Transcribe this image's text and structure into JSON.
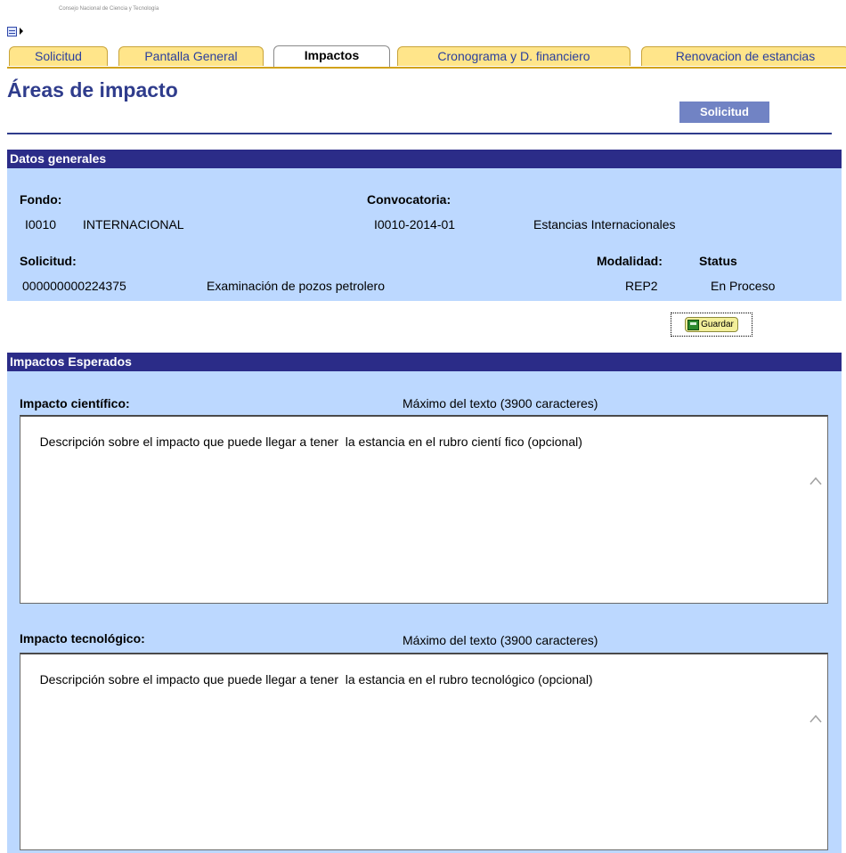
{
  "header": {
    "faint_text": "Consejo Nacional de Ciencia y Tecnología"
  },
  "tabs": [
    {
      "label": "Solicitud",
      "active": false
    },
    {
      "label": "Pantalla General",
      "active": false
    },
    {
      "label": "Impactos",
      "active": true
    },
    {
      "label": "Cronograma y D. financiero",
      "active": false
    },
    {
      "label": "Renovacion de estancias",
      "active": false
    }
  ],
  "page": {
    "title": "Áreas de impacto",
    "solicitud_button": "Solicitud"
  },
  "datos_generales": {
    "header": "Datos generales",
    "fondo_label": "Fondo:",
    "fondo_code": "I0010",
    "fondo_name": "INTERNACIONAL",
    "convocatoria_label": "Convocatoria:",
    "convocatoria_code": "I0010-2014-01",
    "convocatoria_name": "Estancias Internacionales",
    "solicitud_label": "Solicitud:",
    "solicitud_number": "000000000224375",
    "solicitud_desc": "Examinación de pozos petrolero",
    "modalidad_label": "Modalidad:",
    "modalidad_value": "REP2",
    "status_label": "Status",
    "status_value": "En Proceso"
  },
  "guardar_label": "Guardar",
  "impactos": {
    "header": "Impactos Esperados",
    "cientifico_label": "Impacto científico:",
    "cientifico_max": "Máximo del texto (3900 caracteres)",
    "cientifico_text": "Descripción sobre el impacto que puede llegar a tener  la estancia en el rubro cientí fico (opcional)",
    "tecnologico_label": "Impacto tecnológico:",
    "tecnologico_max": "Máximo del texto (3900 caracteres)",
    "tecnologico_text": "Descripción sobre el impacto que puede llegar a tener  la estancia en el rubro tecnológico (opcional)"
  },
  "colors": {
    "section_header": "#2b2c88",
    "panel_bg": "#bcd8ff",
    "tab_bg": "#ffe58a",
    "title": "#2f3c8c"
  }
}
